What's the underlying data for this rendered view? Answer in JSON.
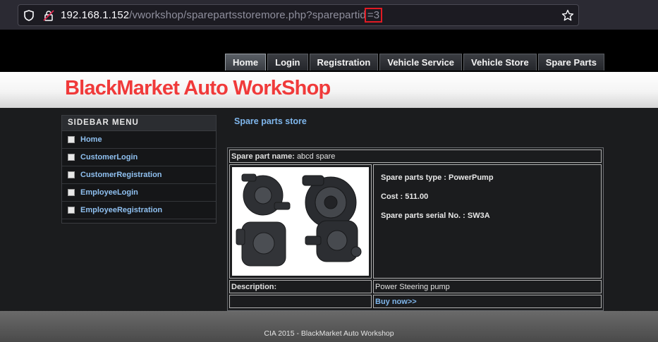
{
  "browser": {
    "url_host": "192.168.1.152",
    "url_path": "/vworkshop/sparepartsstoremore.php?sparepartid",
    "url_highlight": "=3"
  },
  "nav": {
    "tabs": [
      "Home",
      "Login",
      "Registration",
      "Vehicle Service",
      "Vehicle Store",
      "Spare Parts"
    ],
    "active": "Home"
  },
  "site": {
    "title": "BlackMarket Auto WorkShop"
  },
  "sidebar": {
    "heading": "SIDEBAR MENU",
    "items": [
      {
        "label": "Home"
      },
      {
        "label": "CustomerLogin"
      },
      {
        "label": "CustomerRegistration"
      },
      {
        "label": "EmployeeLogin"
      },
      {
        "label": "EmployeeRegistration"
      }
    ]
  },
  "main": {
    "section_title": "Spare parts store",
    "part": {
      "name_label": "Spare part name:",
      "name_value": "abcd spare",
      "type_line": "Spare parts type : PowerPump",
      "cost_line": "Cost : 511.00",
      "serial_line": "Spare parts serial No. : SW3A",
      "description_label": "Description:",
      "description_value": "Power Steering pump",
      "buy_label": "Buy now>>"
    }
  },
  "footer": {
    "text": "CIA 2015 - BlackMarket Auto Workshop"
  }
}
